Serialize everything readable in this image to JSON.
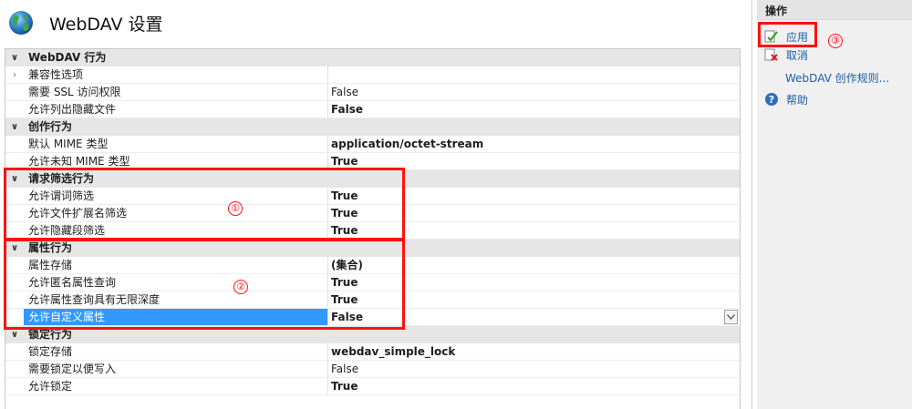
{
  "header": {
    "title": "WebDAV 设置",
    "icon": "globe-icon"
  },
  "grid": {
    "categories": [
      {
        "label": "WebDAV 行为",
        "properties": [
          {
            "name": "兼容性选项",
            "value": "",
            "expandable": true
          },
          {
            "name": "需要 SSL 访问权限",
            "value": "False",
            "bold": false
          },
          {
            "name": "允许列出隐藏文件",
            "value": "False",
            "bold": true
          }
        ]
      },
      {
        "label": "创作行为",
        "properties": [
          {
            "name": "默认 MIME 类型",
            "value": "application/octet-stream",
            "bold": true
          },
          {
            "name": "允许未知 MIME 类型",
            "value": "True",
            "bold": true
          }
        ]
      },
      {
        "label": "请求筛选行为",
        "properties": [
          {
            "name": "允许谓词筛选",
            "value": "True",
            "bold": true
          },
          {
            "name": "允许文件扩展名筛选",
            "value": "True",
            "bold": true
          },
          {
            "name": "允许隐藏段筛选",
            "value": "True",
            "bold": true
          }
        ]
      },
      {
        "label": "属性行为",
        "properties": [
          {
            "name": "属性存储",
            "value": "(集合)",
            "bold": true
          },
          {
            "name": "允许匿名属性查询",
            "value": "True",
            "bold": true
          },
          {
            "name": "允许属性查询具有无限深度",
            "value": "True",
            "bold": true
          },
          {
            "name": "允许自定义属性",
            "value": "False",
            "bold": true,
            "selected": true
          }
        ]
      },
      {
        "label": "锁定行为",
        "properties": [
          {
            "name": "锁定存储",
            "value": "webdav_simple_lock",
            "bold": true
          },
          {
            "name": "需要锁定以便写入",
            "value": "False",
            "bold": false
          },
          {
            "name": "允许锁定",
            "value": "True",
            "bold": true
          }
        ]
      }
    ]
  },
  "annotations": {
    "marker1": "①",
    "marker2": "②",
    "marker3": "③",
    "color": "#ff1010"
  },
  "actions": {
    "header": "操作",
    "apply": "应用",
    "cancel": "取消",
    "rules": "WebDAV 创作规则...",
    "help": "帮助"
  },
  "colors": {
    "selection": "#3399ff",
    "category_bg": "#e6e6e6",
    "link": "#1f5fa8"
  }
}
